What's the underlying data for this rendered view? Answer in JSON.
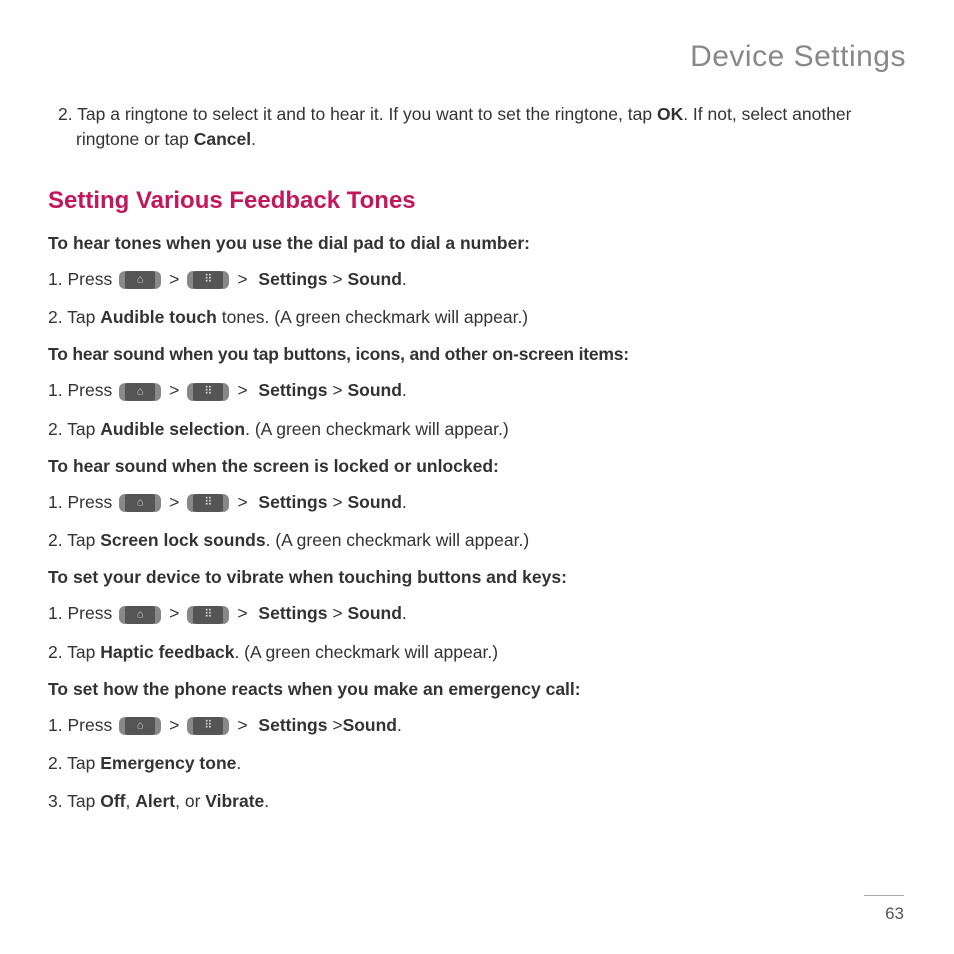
{
  "header": {
    "title": "Device Settings"
  },
  "intro": {
    "step2_prefix": "2. Tap a ringtone to select it and to hear it. If you want to set the ringtone, tap ",
    "ok": "OK",
    "step2_mid": ". If not, select another ringtone or tap ",
    "cancel": "Cancel",
    "step2_suffix": "."
  },
  "section": {
    "heading": "Setting Various Feedback Tones"
  },
  "nav": {
    "press": "Press ",
    "sep": ">",
    "settings": "Settings",
    "sound": "Sound"
  },
  "blocks": [
    {
      "sub": "To hear tones when you use the dial pad to dial a number:",
      "step1_num": "1. ",
      "step2_pre": "2. Tap ",
      "step2_bold": "Audible touch",
      "step2_post": " tones. (A green checkmark will appear.)"
    },
    {
      "sub": "To hear sound when you tap buttons, icons, and other on-screen items:",
      "step1_num": "1.  ",
      "step2_pre": "2. Tap ",
      "step2_bold": "Audible selection",
      "step2_post": ". (A green checkmark will appear.)"
    },
    {
      "sub": "To hear sound when the screen is locked or unlocked:",
      "step1_num": "1. ",
      "step2_pre": "2. Tap ",
      "step2_bold": "Screen lock sounds",
      "step2_post": ". (A green checkmark will appear.)"
    },
    {
      "sub": "To set your device to vibrate when touching buttons and keys:",
      "step1_num": "1. ",
      "step2_pre": "2. Tap ",
      "step2_bold": "Haptic feedback",
      "step2_post": ". (A green checkmark will appear.)"
    }
  ],
  "emergency": {
    "sub": "To set how the phone reacts when you make an emergency call:",
    "step1_num": "1. ",
    "nav_sep2": " >",
    "step2_pre": "2. Tap ",
    "step2_bold": "Emergency tone",
    "step2_post": ".",
    "step3_pre": "3. Tap ",
    "off": "Off",
    "c1": ", ",
    "alert": "Alert",
    "c2": ", or ",
    "vibrate": "Vibrate",
    "step3_post": "."
  },
  "footer": {
    "page": "63"
  }
}
